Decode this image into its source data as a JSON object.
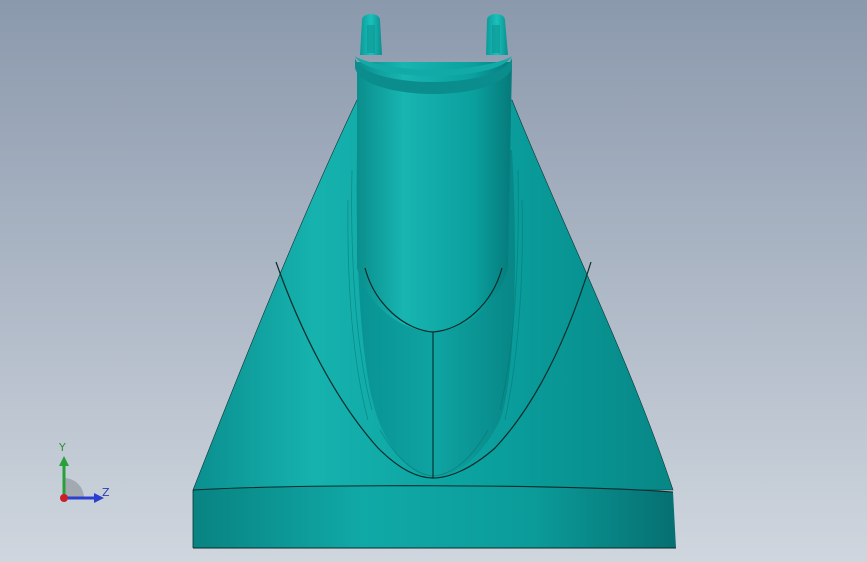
{
  "viewport": {
    "background_top": "#8c9aae",
    "background_bottom": "#cdd4dd",
    "model_color": "#0a9e9e",
    "model_light": "#19b7b4",
    "model_dark": "#067c7e",
    "edge_color": "#0b2b2b"
  },
  "triad": {
    "y_label": "Y",
    "z_label": "Z",
    "y_color": "#27a03a",
    "z_color": "#2b3fd0",
    "x_color": "#c8202a"
  }
}
